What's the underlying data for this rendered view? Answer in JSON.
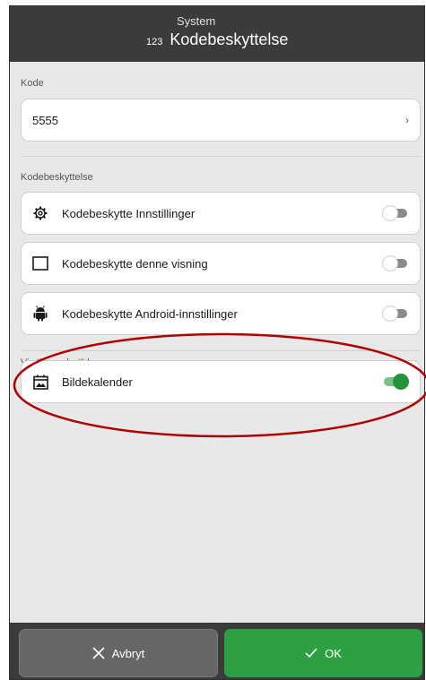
{
  "header": {
    "breadcrumb": "System",
    "title_number": "123",
    "title": "Kodebeskyttelse"
  },
  "code_section": {
    "label": "Kode",
    "value": "5555",
    "chevron": "›"
  },
  "protection_section": {
    "label": "Kodebeskyttelse",
    "items": [
      {
        "label": "Kodebeskytte Innstillinger",
        "icon": "gear-icon",
        "enabled": false
      },
      {
        "label": "Kodebeskytte denne visning",
        "icon": "square-icon",
        "enabled": false
      },
      {
        "label": "Kodebeskytte Android-innstillinger",
        "icon": "android-icon",
        "enabled": false
      }
    ]
  },
  "device_section": {
    "label": "Vis \"las enhet\"-knapp",
    "items": [
      {
        "label": "Bildekalender",
        "icon": "calendar-photo-icon",
        "enabled": true
      }
    ]
  },
  "footer": {
    "cancel_label": "Avbryt",
    "ok_label": "OK"
  },
  "colors": {
    "topbar": "#3b3b3b",
    "accent_green": "#2ea043",
    "toggle_on": "#23943a",
    "annotation": "#b00000"
  }
}
